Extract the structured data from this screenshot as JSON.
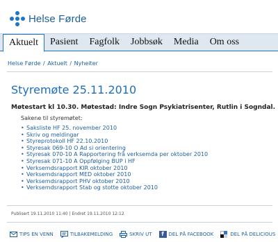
{
  "brand": {
    "name": "Helse Førde",
    "color": "#1d76c8"
  },
  "nav": {
    "tabs": [
      {
        "label": "Aktuelt",
        "active": true
      },
      {
        "label": "Pasient"
      },
      {
        "label": "Fagfolk"
      },
      {
        "label": "Jobbsøk"
      },
      {
        "label": "Media"
      },
      {
        "label": "Om oss"
      }
    ]
  },
  "breadcrumb": [
    "Helse Førde",
    "Aktuelt",
    "Nyheiter"
  ],
  "article": {
    "title": "Styremøte 25.11.2010",
    "intro": "Møtestart kl 10.30. Møtestad: Indre Sogn Psykiatrisenter, Rutlin i Sogndal.",
    "sub": "Sakene til styremøtet:",
    "documents": [
      "Saksliste HF 25. november 2010",
      "Skriv og meldingar",
      "Styreprotokoll HF 22.10.2010",
      "Styresak 069-10 O Ad si orientering",
      "Styresak 070-10 A Rapportering frå verksemda per oktober 2010",
      "Styresak 071-10 A Oppfølging BUP i HF",
      "Verksemdsrapport KIR oktober 2010",
      "Verksemdsrapport MED oktober 2010",
      "Verksemdsrapport PHV oktober 2010",
      "Verksemdsrapport Stab og stotte oktober 2010"
    ],
    "meta": "Publisert 19.11.2010 11:40 | Endret 19.11.2010 12:12"
  },
  "actions": [
    {
      "label": "TIPS EN VENN",
      "icon": "mail-icon"
    },
    {
      "label": "TILBAKEMELDING",
      "icon": "feedback-icon"
    },
    {
      "label": "SKRIV UT",
      "icon": "print-icon"
    },
    {
      "label": "DEL PÅ FACEBOOK",
      "icon": "facebook-icon"
    },
    {
      "label": "DEL PÅ DELICIOUS",
      "icon": "delicious-icon"
    }
  ]
}
